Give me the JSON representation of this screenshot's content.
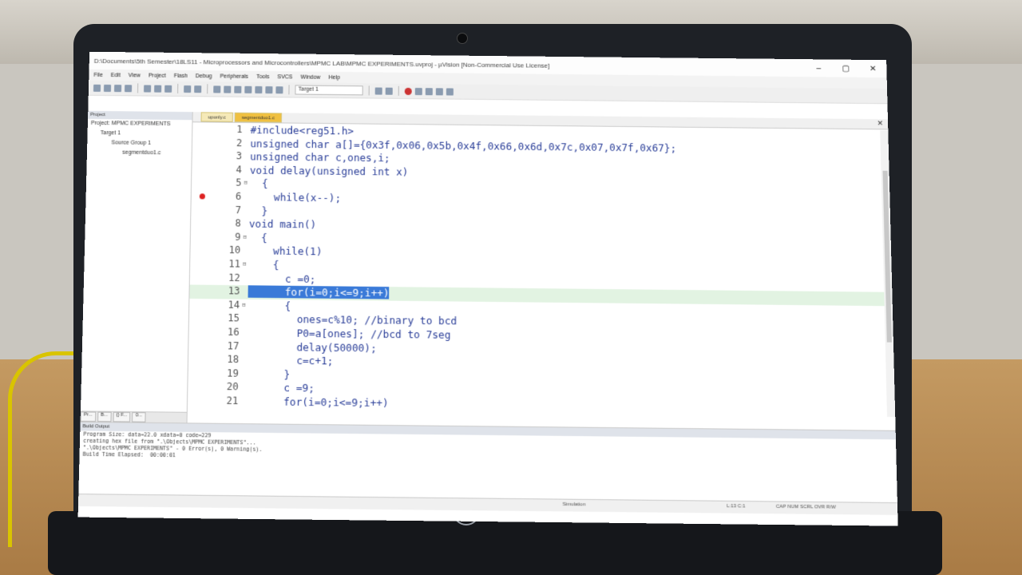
{
  "window": {
    "title": "D:\\Documents\\5th Semester\\18LS11 - Microprocessors and Microcontrollers\\MPMC LAB\\MPMC EXPERIMENTS.uvproj - µVision  [Non-Commercial Use License]",
    "min": "–",
    "max": "▢",
    "close": "✕"
  },
  "menu": [
    "File",
    "Edit",
    "View",
    "Project",
    "Flash",
    "Debug",
    "Peripherals",
    "Tools",
    "SVCS",
    "Window",
    "Help"
  ],
  "toolbar": {
    "target": "Target 1"
  },
  "project": {
    "header": "Project",
    "tree": [
      "Project: MPMC EXPERIMENTS",
      "Target 1",
      "Source Group 1",
      "segmentduo1.c"
    ],
    "tabs": [
      "Pr...",
      "B...",
      "{} F...",
      "0..."
    ]
  },
  "editor": {
    "tabs": [
      "uponly.c",
      "segmentduo1.c"
    ],
    "close": "✕",
    "lines": [
      {
        "n": "1",
        "code": "#include<reg51.h>"
      },
      {
        "n": "2",
        "code": "unsigned char a[]={0x3f,0x06,0x5b,0x4f,0x66,0x6d,0x7c,0x07,0x7f,0x67};"
      },
      {
        "n": "3",
        "code": "unsigned char c,ones,i;"
      },
      {
        "n": "4",
        "code": "void delay(unsigned int x)"
      },
      {
        "n": "5",
        "code": "  {"
      },
      {
        "n": "6",
        "code": "    while(x--);"
      },
      {
        "n": "7",
        "code": "  }"
      },
      {
        "n": "8",
        "code": "void main()"
      },
      {
        "n": "9",
        "code": "  {"
      },
      {
        "n": "10",
        "code": "    while(1)"
      },
      {
        "n": "11",
        "code": "    {"
      },
      {
        "n": "12",
        "code": "      c =0;"
      },
      {
        "n": "13",
        "code": "      for(i=0;i<=9;i++)"
      },
      {
        "n": "14",
        "code": "      {"
      },
      {
        "n": "15",
        "code": "        ones=c%10; //binary to bcd"
      },
      {
        "n": "16",
        "code": "        P0=a[ones]; //bcd to 7seg"
      },
      {
        "n": "17",
        "code": "        delay(50000);"
      },
      {
        "n": "18",
        "code": "        c=c+1;"
      },
      {
        "n": "19",
        "code": "      }"
      },
      {
        "n": "20",
        "code": "      c =9;"
      },
      {
        "n": "21",
        "code": "      for(i=0;i<=9;i++)"
      }
    ]
  },
  "build": {
    "header": "Build Output",
    "lines": [
      "Program Size: data=22.0 xdata=0 code=229",
      "creating hex file from \".\\Objects\\MPMC EXPERIMENTS\"...",
      "\".\\Objects\\MPMC EXPERIMENTS\" - 0 Error(s), 0 Warning(s).",
      "Build Time Elapsed:  00:00:01"
    ]
  },
  "status": {
    "mode": "Simulation",
    "position": "L:13 C:1",
    "keys": "CAP  NUM  SCRL  OVR  R/W"
  },
  "laptop": {
    "brand": "hp"
  }
}
